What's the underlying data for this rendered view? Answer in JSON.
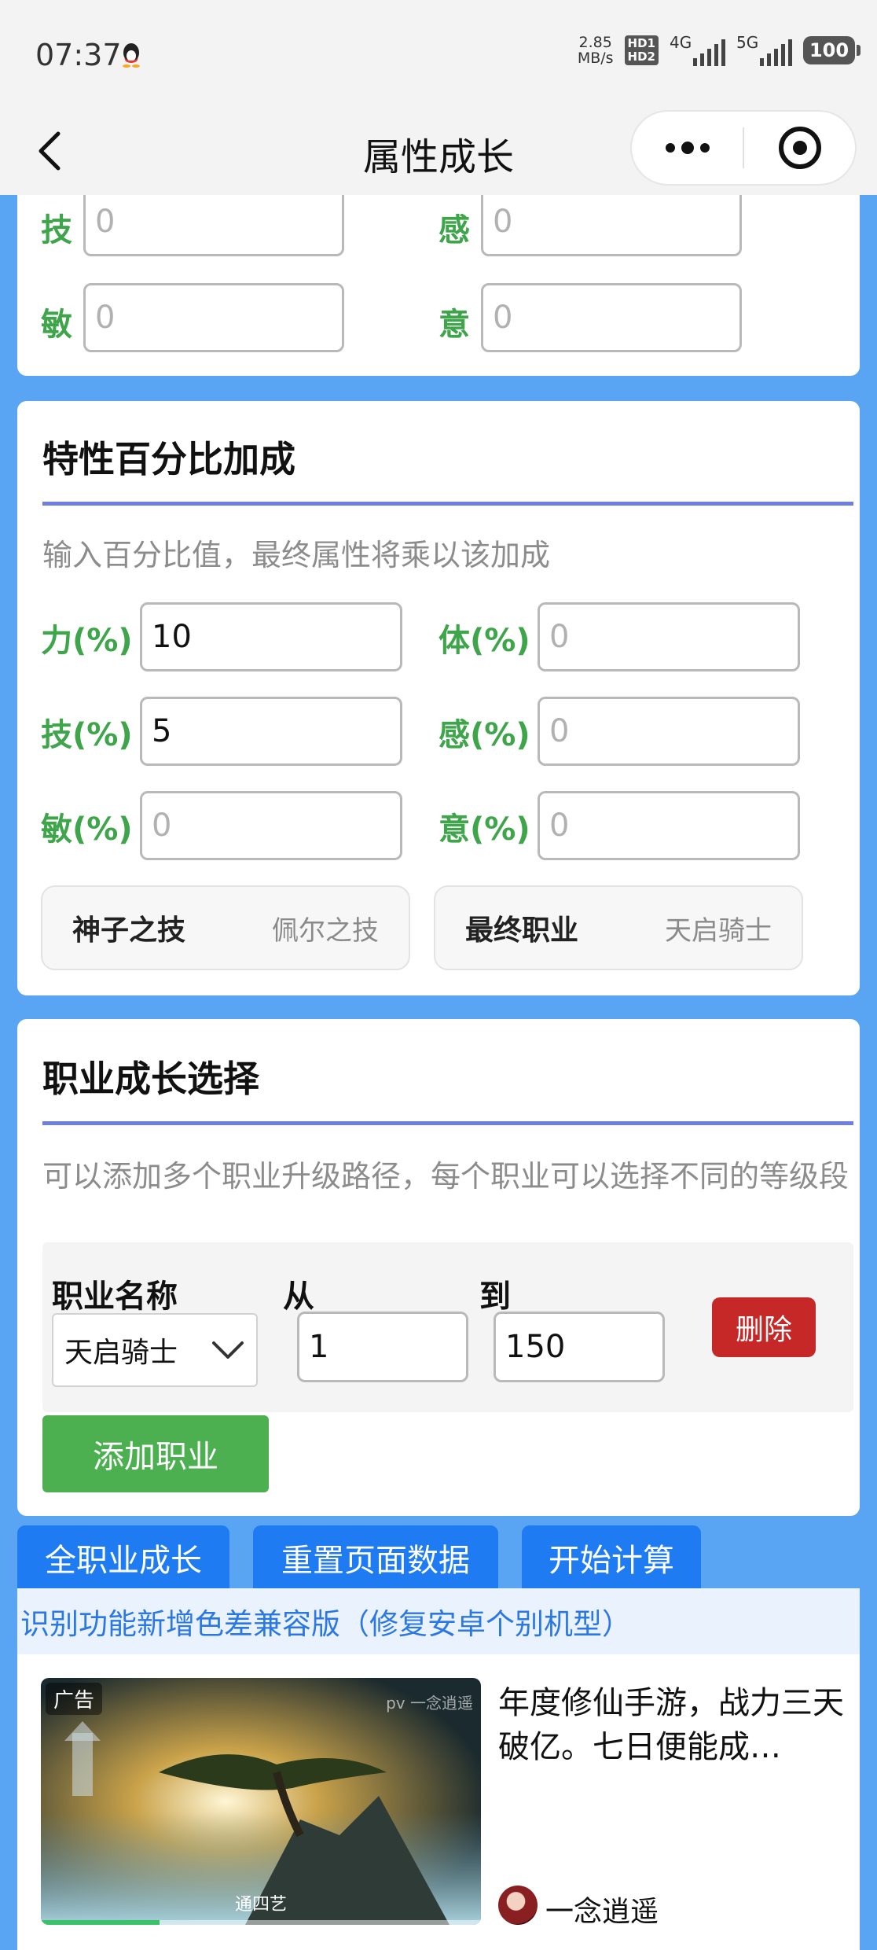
{
  "status_bar": {
    "time": "07:37",
    "net_speed_value": "2.85",
    "net_speed_unit": "MB/s",
    "hd1": "HD1",
    "hd2": "HD2",
    "sig1": "4G",
    "sig2": "5G",
    "battery": "100"
  },
  "nav": {
    "title": "属性成长"
  },
  "base_stats": [
    {
      "label": "技",
      "value": "0"
    },
    {
      "label": "感",
      "value": "0"
    },
    {
      "label": "敏",
      "value": "0"
    },
    {
      "label": "意",
      "value": "0"
    }
  ],
  "percent_section": {
    "title": "特性百分比加成",
    "desc": "输入百分比值，最终属性将乘以该加成",
    "fields": [
      {
        "label": "力(%)",
        "value": "10"
      },
      {
        "label": "体(%)",
        "value": "0"
      },
      {
        "label": "技(%)",
        "value": "5"
      },
      {
        "label": "感(%)",
        "value": "0"
      },
      {
        "label": "敏(%)",
        "value": "0"
      },
      {
        "label": "意(%)",
        "value": "0"
      }
    ],
    "info": [
      {
        "key": "神子之技",
        "value": "佩尔之技"
      },
      {
        "key": "最终职业",
        "value": "天启骑士"
      }
    ]
  },
  "job_section": {
    "title": "职业成长选择",
    "desc": "可以添加多个职业升级路径，每个职业可以选择不同的等级段",
    "col_name": "职业名称",
    "col_from": "从",
    "col_to": "到",
    "job_selected": "天启骑士",
    "from_value": "1",
    "to_value": "150",
    "delete_label": "删除",
    "add_label": "添加职业"
  },
  "actions": [
    "全职业成长",
    "重置页面数据",
    "开始计算"
  ],
  "notice": "识别功能新增色差兼容版（修复安卓个别机型）",
  "ad": {
    "tag": "广告",
    "watermark": "pv 一念逍遥",
    "caption": "通四艺",
    "title": "年度修仙手游，战力三天破亿。七日便能成…",
    "author": "一念逍遥",
    "progress": 0.27
  }
}
